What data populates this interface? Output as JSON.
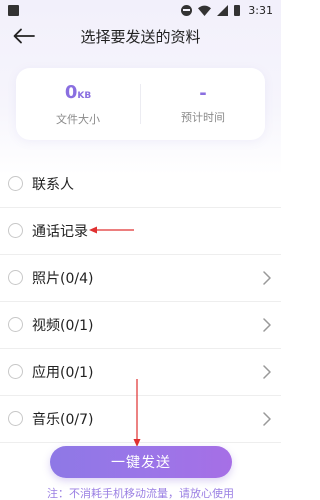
{
  "status_bar": {
    "time": "3:31",
    "icons": [
      "notification-icon",
      "dnd-icon",
      "wifi-icon",
      "signal-icon",
      "battery-icon"
    ]
  },
  "header": {
    "title": "选择要发送的资料",
    "back_icon": "back-arrow-icon"
  },
  "info_card": {
    "size_value": "0",
    "size_unit": "KB",
    "size_label": "文件大小",
    "time_value": "-",
    "time_label": "预计时间"
  },
  "list": {
    "items": [
      {
        "label": "联系人",
        "has_chevron": false
      },
      {
        "label": "通话记录",
        "has_chevron": false
      },
      {
        "label": "照片(0/4)",
        "has_chevron": true
      },
      {
        "label": "视频(0/1)",
        "has_chevron": true
      },
      {
        "label": "应用(0/1)",
        "has_chevron": true
      },
      {
        "label": "音乐(0/7)",
        "has_chevron": true
      }
    ]
  },
  "send_button": {
    "label": "一键发送"
  },
  "footer_note": "注：不消耗手机移动流量，请放心使用",
  "colors": {
    "accent": "#8a6fe0",
    "annotation_arrow": "#e03030",
    "button_gradient_start": "#8e78e6",
    "button_gradient_end": "#a66fe6"
  }
}
